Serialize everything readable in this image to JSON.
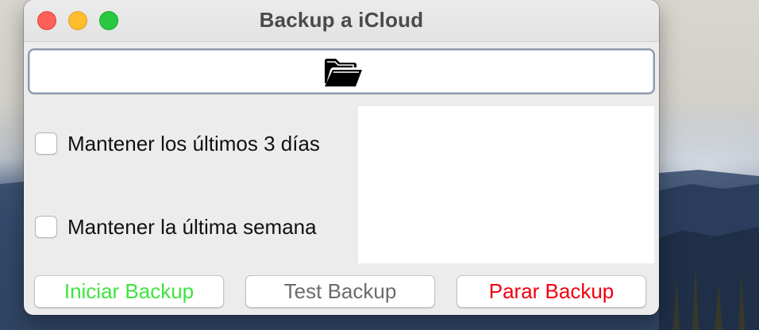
{
  "window": {
    "title": "Backup a iCloud"
  },
  "folder_button": {
    "icon": "open-folder-icon"
  },
  "options": [
    {
      "label": "Mantener los últimos 3 días",
      "checked": false
    },
    {
      "label": "Mantener la última semana",
      "checked": false
    }
  ],
  "log_area": {
    "text": ""
  },
  "buttons": {
    "start": {
      "label": "Iniciar Backup",
      "color": "#3de63d"
    },
    "test": {
      "label": "Test Backup",
      "color": "#6b6b6b"
    },
    "stop": {
      "label": "Parar Backup",
      "color": "#f0000f"
    }
  }
}
